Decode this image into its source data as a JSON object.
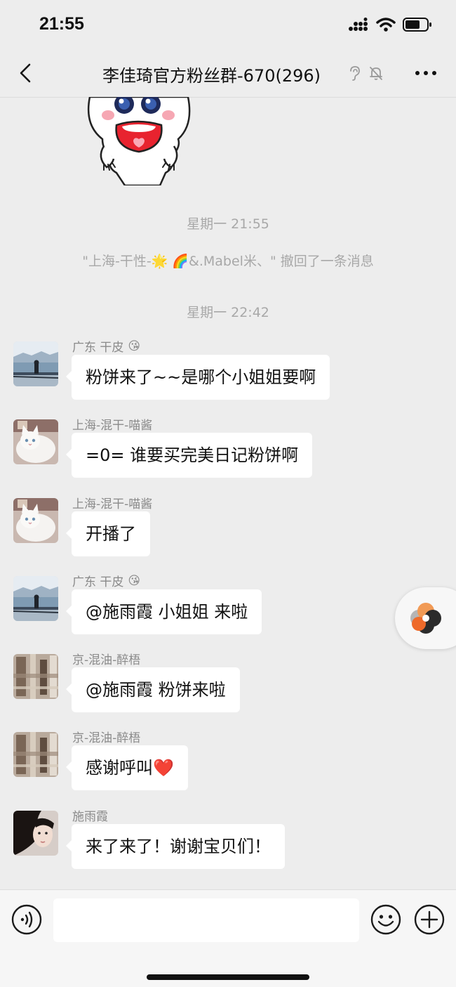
{
  "status_bar": {
    "time": "21:55"
  },
  "nav": {
    "title": "李佳琦官方粉丝群-670(296)"
  },
  "system_messages": {
    "time_1": "星期一 21:55",
    "recall": "\"上海-干性-🌟 🌈&.Mabel米、\" 撤回了一条消息",
    "time_2": "星期一 22:42"
  },
  "messages": [
    {
      "sender": "广东 干皮",
      "sender_emoji": "😘",
      "text": "粉饼来了~~是哪个小姐姐要啊",
      "avatar": "lake-person-avatar"
    },
    {
      "sender": "上海-混干-喵酱",
      "sender_emoji": "",
      "text": "=0= 谁要买完美日记粉饼啊",
      "avatar": "white-cat-avatar"
    },
    {
      "sender": "上海-混干-喵酱",
      "sender_emoji": "",
      "text": "开播了",
      "avatar": "white-cat-avatar"
    },
    {
      "sender": "广东 干皮",
      "sender_emoji": "😘",
      "text": "@施雨霞 小姐姐 来啦",
      "avatar": "lake-person-avatar"
    },
    {
      "sender": "京-混油-醉梧",
      "sender_emoji": "",
      "text": "@施雨霞 粉饼来啦",
      "avatar": "blurred-room-avatar"
    },
    {
      "sender": "京-混油-醉梧",
      "sender_emoji": "",
      "text": "感谢呼叫❤️",
      "avatar": "blurred-room-avatar"
    },
    {
      "sender": "施雨霞",
      "sender_emoji": "",
      "text": "来了来了！谢谢宝贝们！",
      "avatar": "girl-portrait-avatar"
    }
  ],
  "input": {
    "value": "",
    "placeholder": ""
  },
  "colors": {
    "background": "#ededed",
    "bubble": "#ffffff",
    "system_text": "#a8a8a8",
    "sender_text": "#8a8a8a"
  }
}
